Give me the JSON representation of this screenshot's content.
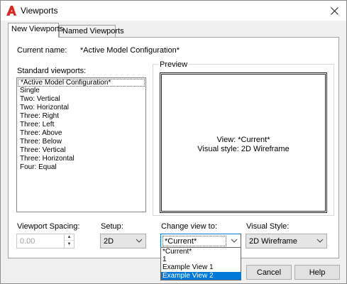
{
  "window": {
    "title": "Viewports",
    "app_icon": "autocad-a-icon",
    "close_icon": "close-icon"
  },
  "tabs": [
    {
      "label": "New Viewports",
      "active": true
    },
    {
      "label": "Named Viewports",
      "active": false
    }
  ],
  "current_name": {
    "label": "Current name:",
    "value": "*Active Model Configuration*"
  },
  "standard_viewports": {
    "label": "Standard viewports:",
    "items": [
      "*Active Model Configuration*",
      "Single",
      "Two:  Vertical",
      "Two:  Horizontal",
      "Three: Right",
      "Three: Left",
      "Three: Above",
      "Three: Below",
      "Three: Vertical",
      "Three: Horizontal",
      "Four:  Equal"
    ],
    "selected_index": 0
  },
  "preview": {
    "label": "Preview",
    "view_line": "View: *Current*",
    "style_line": "Visual style: 2D Wireframe"
  },
  "viewport_spacing": {
    "label": "Viewport Spacing:",
    "value": "0.00"
  },
  "setup": {
    "label": "Setup:",
    "value": "2D"
  },
  "change_view": {
    "label": "Change view to:",
    "value": "*Current*",
    "options": [
      "*Current*",
      "1",
      "Example View 1",
      "Example View 2"
    ],
    "highlighted_index": 3
  },
  "visual_style": {
    "label": "Visual Style:",
    "value": "2D Wireframe"
  },
  "buttons": {
    "cancel": "Cancel",
    "help": "Help"
  },
  "colors": {
    "accent": "#0078d7",
    "app_icon_red": "#e2231a"
  }
}
